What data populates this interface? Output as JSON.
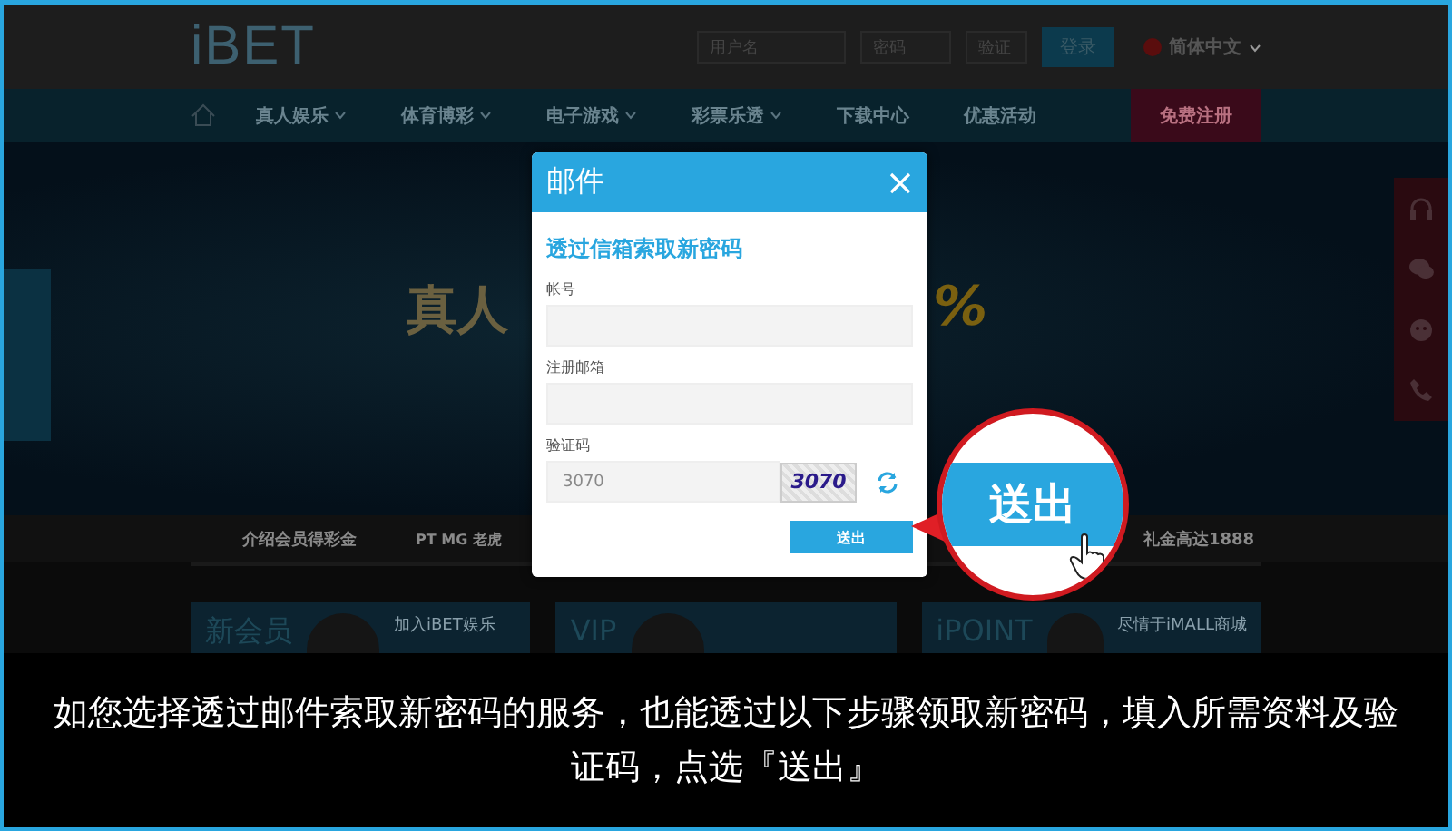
{
  "header": {
    "logo": "iBET",
    "username_field": {
      "placeholder": "用户名"
    },
    "password_field": {
      "placeholder": "密码"
    },
    "code_field": {
      "placeholder": "验证"
    },
    "login_button": "登录",
    "language": "简体中文"
  },
  "nav": {
    "items": [
      {
        "label": "真人娱乐",
        "dropdown": true
      },
      {
        "label": "体育博彩",
        "dropdown": true
      },
      {
        "label": "电子游戏",
        "dropdown": true
      },
      {
        "label": "彩票乐透",
        "dropdown": true
      },
      {
        "label": "下载中心",
        "dropdown": false
      },
      {
        "label": "优惠活动",
        "dropdown": false
      }
    ],
    "register_button": "免费注册"
  },
  "hero": {
    "headline": "真人",
    "percent": "%"
  },
  "promo_tabs": [
    "介绍会员得彩金",
    "PT MG 老虎",
    "礼金高达1888"
  ],
  "cards": [
    {
      "title": "新会员",
      "text": "加入iBET娱乐"
    },
    {
      "title": "VIP"
    },
    {
      "title": "iPOINT",
      "text": "尽情于iMALL商城"
    }
  ],
  "dialog": {
    "title": "邮件",
    "heading": "透过信箱索取新密码",
    "fields": [
      {
        "kind": "text",
        "label": "帐号"
      },
      {
        "kind": "text",
        "label": "注册邮箱"
      },
      {
        "kind": "captcha",
        "label": "验证码",
        "value": "3070",
        "captcha": "3070"
      }
    ],
    "submit": "送出"
  },
  "callout": {
    "label": "送出"
  },
  "caption": "如您选择透过邮件索取新密码的服务，也能透过以下步骤领取新密码，填入所需资料及验证码，点选『送出』"
}
